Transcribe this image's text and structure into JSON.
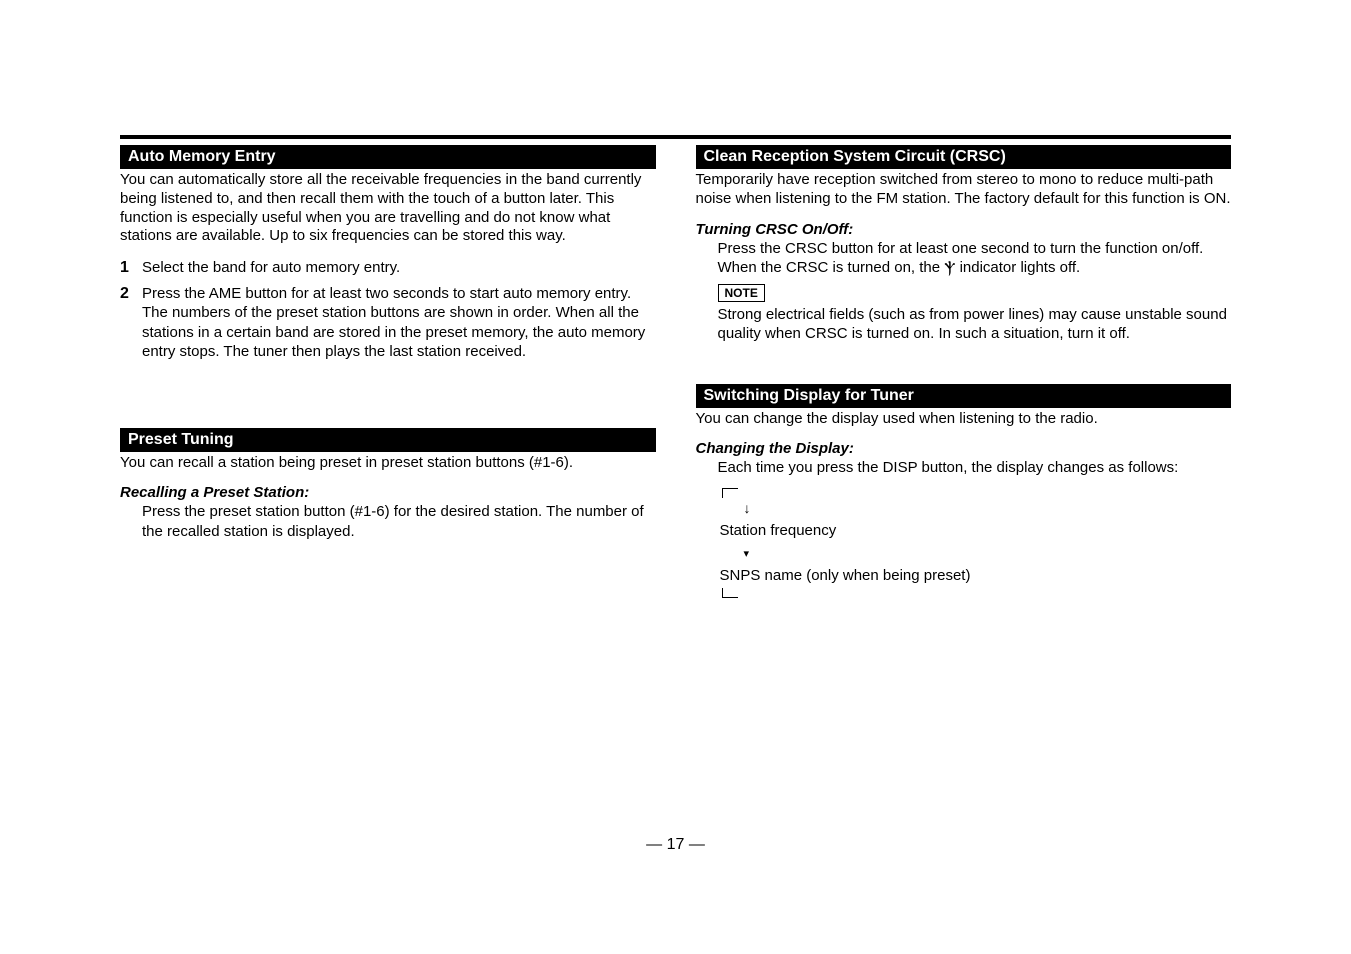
{
  "left": {
    "auto_memory": {
      "heading": "Auto Memory Entry",
      "intro": "You can automatically store all the receivable frequencies in the band currently being listened to, and then recall them with the touch of a button later. This function is especially useful when you are travelling and do not know what stations are available.  Up to six frequencies can be stored this way.",
      "steps": [
        {
          "num": "1",
          "text": "Select the band for auto memory entry."
        },
        {
          "num": "2",
          "text": "Press the AME button for at least two seconds to start auto memory entry.",
          "cont": "The numbers of the preset station buttons are shown in order. When all the stations in a certain band are stored in the preset memory, the auto memory entry stops. The tuner then plays the last station received."
        }
      ]
    },
    "preset": {
      "heading": "Preset Tuning",
      "intro": "You can recall a station being preset in preset station buttons (#1-6).",
      "sub_h": "Recalling a Preset Station:",
      "body": "Press the preset station button (#1-6) for the desired station. The number of the recalled station is displayed."
    }
  },
  "right": {
    "crsc": {
      "heading": "Clean Reception System Circuit (CRSC)",
      "intro": "Temporarily have reception switched from stereo to mono to reduce multi-path noise when listening to the FM station. The factory default for this function is ON.",
      "sub_h": "Turning CRSC On/Off:",
      "body1": "Press the CRSC button for at least one second to turn the function on/off.",
      "body2a": "When the CRSC is turned on, the ",
      "body2b": " indicator lights off.",
      "note_label": "NOTE",
      "note_text": "Strong electrical fields (such as from power lines) may cause unstable sound quality when CRSC is turned on. In such a situation, turn it off."
    },
    "display": {
      "heading": "Switching Display for Tuner",
      "intro": "You can change the display used when listening to the radio.",
      "sub_h": "Changing the Display:",
      "body": "Each time you press the DISP button, the display changes as follows:",
      "flow1": "Station frequency",
      "flow2": "SNPS name (only when being preset)"
    }
  },
  "page_number": "— 17 —",
  "icons": {
    "arrow_down_hook": "↓",
    "arrow_small": "▾",
    "y_indicator": "Ⲯ"
  }
}
